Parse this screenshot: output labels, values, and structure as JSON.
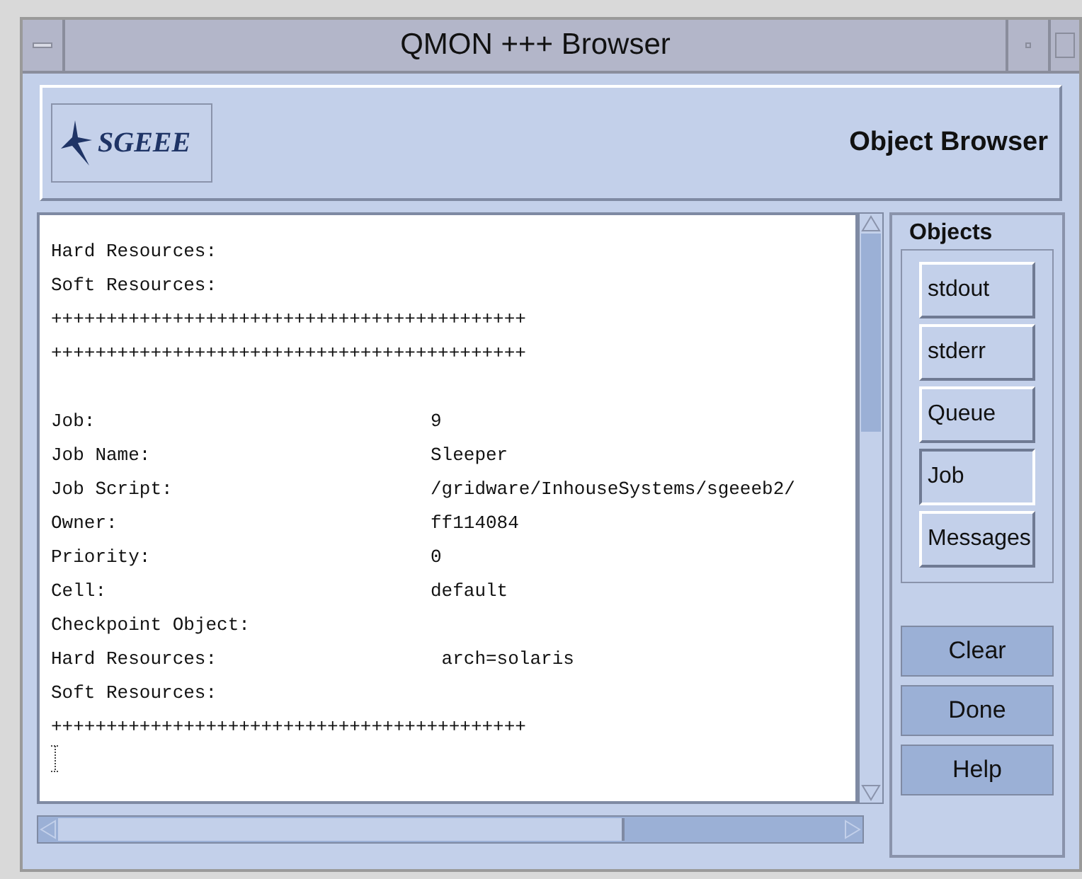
{
  "window": {
    "title": "QMON +++ Browser"
  },
  "header": {
    "logo_text": "SGEEE",
    "title": "Object Browser"
  },
  "output_lines": [
    {
      "kind": "field",
      "label": "Hard Resources:"
    },
    {
      "kind": "field",
      "label": "Soft Resources:"
    },
    {
      "kind": "separator",
      "text": "+++++++++++++++++++++++++++++++++++++++++++"
    },
    {
      "kind": "separator",
      "text": "+++++++++++++++++++++++++++++++++++++++++++"
    },
    {
      "kind": "blank"
    },
    {
      "kind": "field",
      "label": "Job:",
      "value": "9"
    },
    {
      "kind": "field",
      "label": "Job Name:",
      "value": "Sleeper"
    },
    {
      "kind": "field",
      "label": "Job Script:",
      "value": "/gridware/InhouseSystems/sgeeeb2/"
    },
    {
      "kind": "field",
      "label": "Owner:",
      "value": "ff114084"
    },
    {
      "kind": "field",
      "label": "Priority:",
      "value": "0"
    },
    {
      "kind": "field",
      "label": "Cell:",
      "value": "default"
    },
    {
      "kind": "field",
      "label": "Checkpoint Object:"
    },
    {
      "kind": "field",
      "label": "Hard Resources:",
      "value": " arch=solaris"
    },
    {
      "kind": "field",
      "label": "Soft Resources:"
    },
    {
      "kind": "separator",
      "text": "+++++++++++++++++++++++++++++++++++++++++++"
    }
  ],
  "objects": {
    "title": "Objects",
    "buttons": [
      {
        "label": "stdout",
        "selected": false
      },
      {
        "label": "stderr",
        "selected": false
      },
      {
        "label": "Queue",
        "selected": false
      },
      {
        "label": "Job",
        "selected": true
      },
      {
        "label": "Messages",
        "selected": false
      }
    ]
  },
  "actions": [
    "Clear",
    "Done",
    "Help"
  ]
}
